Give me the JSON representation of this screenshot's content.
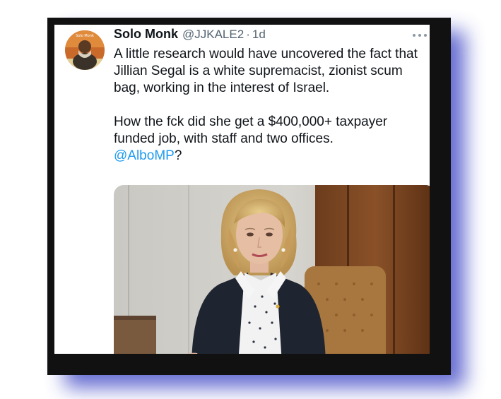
{
  "tweet": {
    "display_name": "Solo Monk",
    "handle": "@JJKALE2",
    "separator": "·",
    "time": "1d",
    "avatar_label": "Solo Monk",
    "paragraph_1": "A little research would have uncovered the fact that Jillian Segal is a white supremacist, zionist scum bag, working in the interest of Israel.",
    "paragraph_2": "How the fck did she get a $400,000+ taxpayer funded job, with staff and two offices.",
    "mention": "@AlboMP",
    "mention_suffix": "?"
  },
  "icons": {
    "more": "more-options-icon"
  },
  "colors": {
    "frame_shadow": "#4a52c8",
    "frame": "#111111",
    "mention": "#1d9bf0",
    "handle": "#536471"
  }
}
